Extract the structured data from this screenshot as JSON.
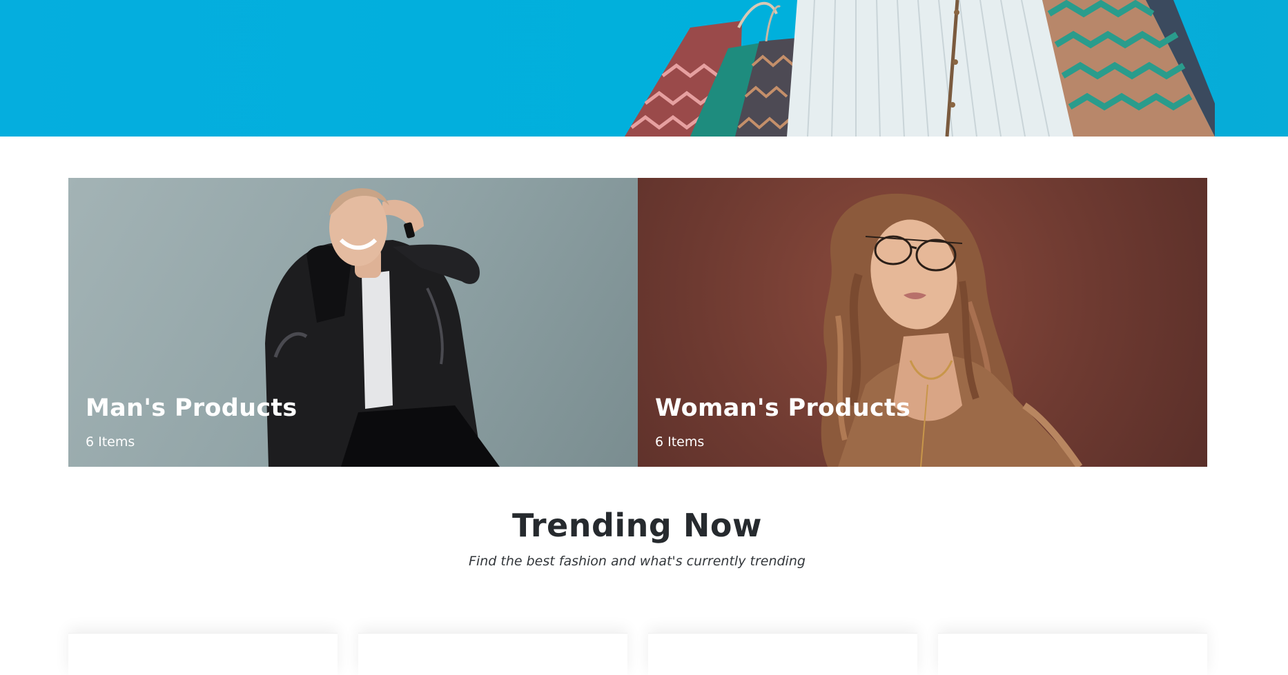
{
  "hero": {
    "background_color": "#00b0dc",
    "image": "shopping-bags-woman-white-skirt"
  },
  "categories": [
    {
      "title": "Man's Products",
      "count": "6 Items",
      "image": "man-leather-jacket",
      "background_color": "#8fa2a5"
    },
    {
      "title": "Woman's Products",
      "count": "6 Items",
      "image": "woman-glasses-fur-coat",
      "background_color": "#6e3a31"
    }
  ],
  "trending": {
    "title": "Trending Now",
    "subtitle": "Find the best fashion and what's currently trending"
  }
}
